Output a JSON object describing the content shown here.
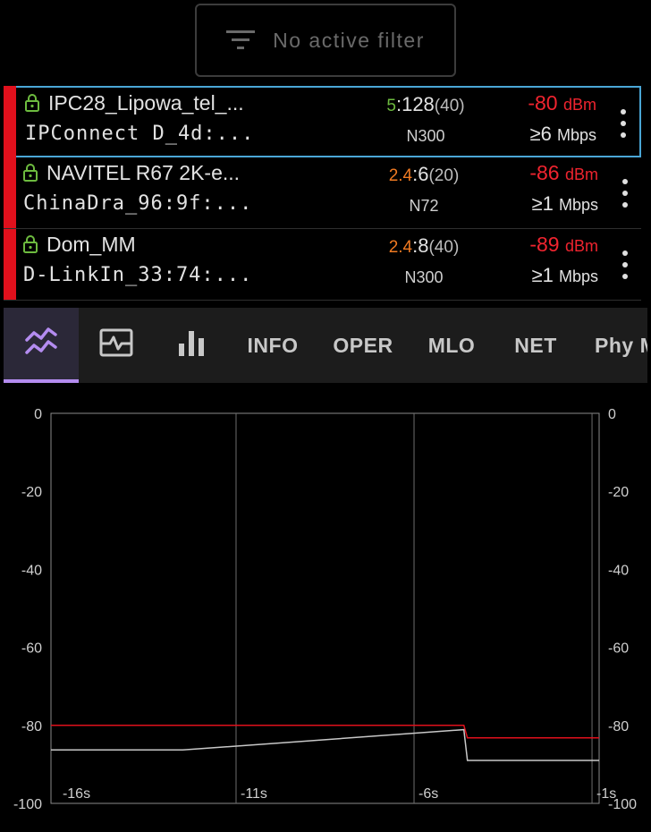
{
  "filter": {
    "label": "No active filter",
    "icon": "filter-icon"
  },
  "networks": [
    {
      "ssid": "IPC28_Lipowa_tel_...",
      "bssid": "IPConnect D_4d:...",
      "band": "5",
      "band_color": "#6dbb3f",
      "channel": ":128",
      "width": "(40)",
      "standard": "N300",
      "rssi": "-80",
      "rssi_unit": "dBm",
      "speed": "≥6",
      "speed_unit": "Mbps",
      "selected": true
    },
    {
      "ssid": "NAVITEL R67 2K-e...",
      "bssid": "ChinaDra_96:9f:...",
      "band": "2.4",
      "band_color": "#f07a22",
      "channel": ":6",
      "width": "(20)",
      "standard": "N72",
      "rssi": "-86",
      "rssi_unit": "dBm",
      "speed": "≥1",
      "speed_unit": "Mbps",
      "selected": false
    },
    {
      "ssid": "Dom_MM",
      "bssid": "D-LinkIn_33:74:...",
      "band": "2.4",
      "band_color": "#f07a22",
      "channel": ":8",
      "width": "(40)",
      "standard": "N300",
      "rssi": "-89",
      "rssi_unit": "dBm",
      "speed": "≥1",
      "speed_unit": "Mbps",
      "selected": false
    }
  ],
  "tabs": {
    "icons": [
      "time-graph-icon",
      "signal-graph-icon",
      "bar-chart-icon"
    ],
    "labels": [
      "INFO",
      "OPER",
      "MLO",
      "NET",
      "Phy M"
    ],
    "active": "time-graph-icon"
  },
  "chart_data": {
    "type": "line",
    "x_ticks": [
      "-16s",
      "-11s",
      "-6s",
      "-1s"
    ],
    "y_ticks": [
      "0",
      "-20",
      "-40",
      "-60",
      "-80",
      "-100"
    ],
    "ylim": [
      -100,
      0
    ],
    "xlim": [
      -16.2,
      -0.8
    ],
    "grid": true,
    "series": [
      {
        "color": "#e0101c",
        "x": [
          -16.2,
          -4.6,
          -4.5,
          -0.8
        ],
        "values": [
          -80,
          -80,
          -83.2,
          -83.2
        ]
      },
      {
        "color": "#c8c8c8",
        "x": [
          -16.2,
          -12.5,
          -4.6,
          -4.5,
          -0.8
        ],
        "values": [
          -86.3,
          -86.3,
          -81.1,
          -89,
          -89
        ]
      }
    ]
  }
}
